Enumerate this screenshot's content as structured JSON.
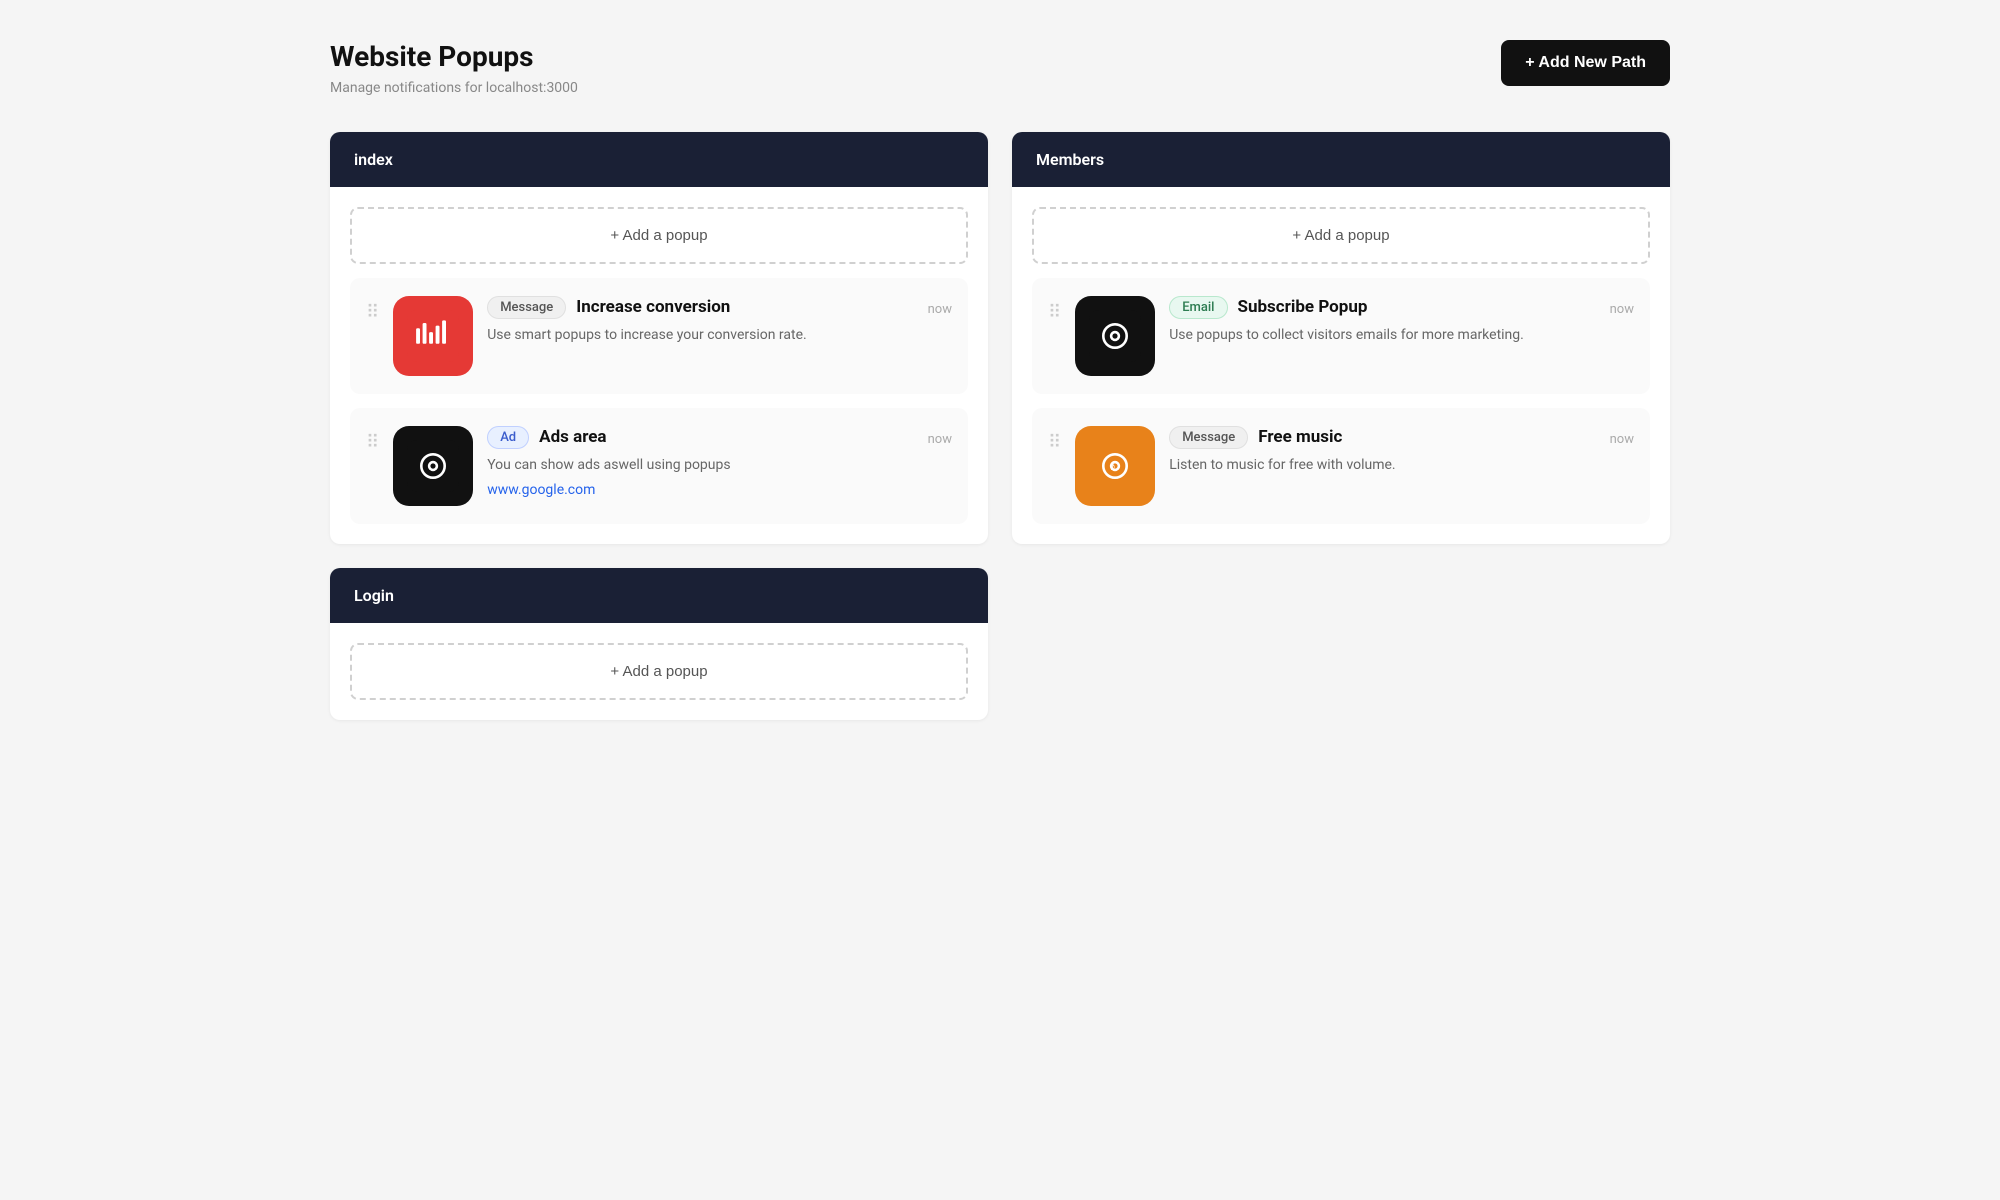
{
  "page": {
    "title": "Website Popups",
    "subtitle": "Manage notifications for localhost:3000"
  },
  "header": {
    "add_button_label": "+ Add New Path"
  },
  "sections": [
    {
      "id": "index",
      "label": "index",
      "add_popup_label": "+ Add a popup",
      "cards": [
        {
          "id": "rise-card",
          "tag": "Message",
          "tag_type": "message",
          "title": "Increase conversion",
          "description": "Use smart popups to increase your conversion rate.",
          "time": "now",
          "icon_type": "rise",
          "icon_bg": "#e53935",
          "link": null
        },
        {
          "id": "ads-card",
          "tag": "Ad",
          "tag_type": "ad",
          "title": "Ads area",
          "description": "You can show ads aswell using popups",
          "time": "now",
          "icon_type": "vision-dark",
          "icon_bg": "#111",
          "link": "www.google.com"
        }
      ]
    },
    {
      "id": "members",
      "label": "Members",
      "add_popup_label": "+ Add a popup",
      "cards": [
        {
          "id": "subscribe-card",
          "tag": "Email",
          "tag_type": "email",
          "title": "Subscribe Popup",
          "description": "Use popups to collect visitors emails for more marketing.",
          "time": "now",
          "icon_type": "vision-dark",
          "icon_bg": "#111",
          "link": null
        },
        {
          "id": "music-card",
          "tag": "Message",
          "tag_type": "message",
          "title": "Free music",
          "description": "Listen to music for free with volume.",
          "time": "now",
          "icon_type": "vision-orange",
          "icon_bg": "#e8821a",
          "link": null
        }
      ]
    },
    {
      "id": "login",
      "label": "Login",
      "add_popup_label": "+ Add a popup",
      "cards": []
    }
  ]
}
